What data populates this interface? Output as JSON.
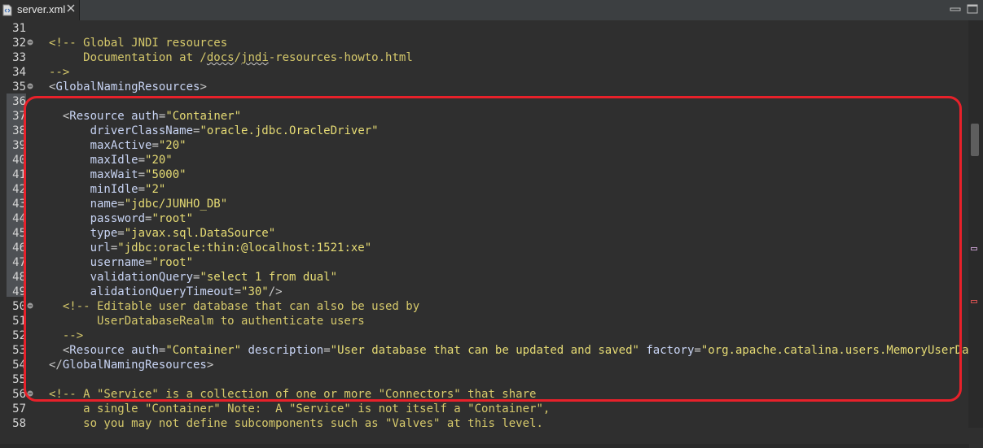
{
  "tab": {
    "file_name": "server.xml",
    "close_icon": "close-icon",
    "file_icon": "xml-file-icon"
  },
  "window_controls": {
    "minimize_icon": "minimize-icon",
    "maximize_icon": "maximize-icon"
  },
  "highlight_color": "#e8212a",
  "lines": [
    {
      "n": "31",
      "fold": false,
      "segments": []
    },
    {
      "n": "32",
      "fold": true,
      "segments": [
        {
          "t": "c-comment",
          "v": "<!-- Global JNDI resources"
        }
      ]
    },
    {
      "n": "33",
      "fold": false,
      "segments": [
        {
          "t": "c-comment",
          "v": "     Documentation at /"
        },
        {
          "t": "c-comment sq",
          "v": "docs"
        },
        {
          "t": "c-comment",
          "v": "/"
        },
        {
          "t": "c-comment sq",
          "v": "jndi"
        },
        {
          "t": "c-comment",
          "v": "-resources-howto.html"
        }
      ]
    },
    {
      "n": "34",
      "fold": false,
      "segments": [
        {
          "t": "c-comment",
          "v": "-->"
        }
      ]
    },
    {
      "n": "35",
      "fold": true,
      "segments": [
        {
          "t": "c-punct",
          "v": "<"
        },
        {
          "t": "c-tag",
          "v": "GlobalNamingResources"
        },
        {
          "t": "c-punct",
          "v": ">"
        }
      ]
    },
    {
      "n": "36",
      "fold": false,
      "segments": []
    },
    {
      "n": "37",
      "fold": false,
      "segments": [
        {
          "t": "c-punct",
          "v": "  <"
        },
        {
          "t": "c-tag",
          "v": "Resource"
        },
        {
          "t": "c-attr",
          "v": " auth"
        },
        {
          "t": "c-punct",
          "v": "="
        },
        {
          "t": "c-val",
          "v": "\"Container\""
        }
      ]
    },
    {
      "n": "38",
      "fold": false,
      "segments": [
        {
          "t": "c-attr",
          "v": "      driverClassName"
        },
        {
          "t": "c-punct",
          "v": "="
        },
        {
          "t": "c-val",
          "v": "\"oracle.jdbc.OracleDriver\""
        }
      ]
    },
    {
      "n": "39",
      "fold": false,
      "segments": [
        {
          "t": "c-attr",
          "v": "      maxActive"
        },
        {
          "t": "c-punct",
          "v": "="
        },
        {
          "t": "c-val",
          "v": "\"20\""
        }
      ]
    },
    {
      "n": "40",
      "fold": false,
      "segments": [
        {
          "t": "c-attr",
          "v": "      maxIdle"
        },
        {
          "t": "c-punct",
          "v": "="
        },
        {
          "t": "c-val",
          "v": "\"20\""
        }
      ]
    },
    {
      "n": "41",
      "fold": false,
      "segments": [
        {
          "t": "c-attr",
          "v": "      maxWait"
        },
        {
          "t": "c-punct",
          "v": "="
        },
        {
          "t": "c-val",
          "v": "\"5000\""
        }
      ]
    },
    {
      "n": "42",
      "fold": false,
      "segments": [
        {
          "t": "c-attr",
          "v": "      minIdle"
        },
        {
          "t": "c-punct",
          "v": "="
        },
        {
          "t": "c-val",
          "v": "\"2\""
        }
      ]
    },
    {
      "n": "43",
      "fold": false,
      "segments": [
        {
          "t": "c-attr",
          "v": "      name"
        },
        {
          "t": "c-punct",
          "v": "="
        },
        {
          "t": "c-val",
          "v": "\"jdbc/JUNHO_DB\""
        }
      ]
    },
    {
      "n": "44",
      "fold": false,
      "segments": [
        {
          "t": "c-attr",
          "v": "      password"
        },
        {
          "t": "c-punct",
          "v": "="
        },
        {
          "t": "c-val",
          "v": "\"root\""
        }
      ]
    },
    {
      "n": "45",
      "fold": false,
      "segments": [
        {
          "t": "c-attr",
          "v": "      type"
        },
        {
          "t": "c-punct",
          "v": "="
        },
        {
          "t": "c-val",
          "v": "\"javax.sql.DataSource\""
        }
      ]
    },
    {
      "n": "46",
      "fold": false,
      "segments": [
        {
          "t": "c-attr",
          "v": "      url"
        },
        {
          "t": "c-punct",
          "v": "="
        },
        {
          "t": "c-val",
          "v": "\"jdbc:oracle:thin:@localhost:1521:xe\""
        }
      ]
    },
    {
      "n": "47",
      "fold": false,
      "segments": [
        {
          "t": "c-attr",
          "v": "      username"
        },
        {
          "t": "c-punct",
          "v": "="
        },
        {
          "t": "c-val",
          "v": "\"root\""
        }
      ]
    },
    {
      "n": "48",
      "fold": false,
      "segments": [
        {
          "t": "c-attr",
          "v": "      validationQuery"
        },
        {
          "t": "c-punct",
          "v": "="
        },
        {
          "t": "c-val",
          "v": "\"select 1 from dual\""
        }
      ]
    },
    {
      "n": "49",
      "fold": false,
      "segments": [
        {
          "t": "c-attr",
          "v": "      alidationQueryTimeout"
        },
        {
          "t": "c-punct",
          "v": "="
        },
        {
          "t": "c-val",
          "v": "\"30\""
        },
        {
          "t": "c-punct",
          "v": "/>"
        }
      ]
    },
    {
      "n": "50",
      "fold": true,
      "segments": [
        {
          "t": "c-comment",
          "v": "  <!-- Editable user database that can also be used by"
        }
      ]
    },
    {
      "n": "51",
      "fold": false,
      "segments": [
        {
          "t": "c-comment",
          "v": "       UserDatabaseRealm to authenticate users"
        }
      ]
    },
    {
      "n": "52",
      "fold": false,
      "segments": [
        {
          "t": "c-comment",
          "v": "  -->"
        }
      ]
    },
    {
      "n": "53",
      "fold": false,
      "segments": [
        {
          "t": "c-punct",
          "v": "  <"
        },
        {
          "t": "c-tag",
          "v": "Resource"
        },
        {
          "t": "c-attr",
          "v": " auth"
        },
        {
          "t": "c-punct",
          "v": "="
        },
        {
          "t": "c-val",
          "v": "\"Container\""
        },
        {
          "t": "c-attr",
          "v": " description"
        },
        {
          "t": "c-punct",
          "v": "="
        },
        {
          "t": "c-val",
          "v": "\"User database that can be updated and saved\""
        },
        {
          "t": "c-attr",
          "v": " factory"
        },
        {
          "t": "c-punct",
          "v": "="
        },
        {
          "t": "c-val",
          "v": "\"org.apache.catalina.users.MemoryUserDatabase"
        }
      ]
    },
    {
      "n": "54",
      "fold": false,
      "segments": [
        {
          "t": "c-punct",
          "v": "</"
        },
        {
          "t": "c-tag",
          "v": "GlobalNamingResources"
        },
        {
          "t": "c-punct",
          "v": ">"
        }
      ]
    },
    {
      "n": "55",
      "fold": false,
      "segments": []
    },
    {
      "n": "56",
      "fold": true,
      "segments": [
        {
          "t": "c-comment",
          "v": "<!-- A \"Service\" is a collection of one or more \"Connectors\" that share"
        }
      ]
    },
    {
      "n": "57",
      "fold": false,
      "segments": [
        {
          "t": "c-comment",
          "v": "     a single \"Container\" Note:  A \"Service\" is not itself a \"Container\","
        }
      ]
    },
    {
      "n": "58",
      "fold": false,
      "segments": [
        {
          "t": "c-comment",
          "v": "     so you may not define subcomponents such as \"Valves\" at this level."
        }
      ]
    }
  ]
}
